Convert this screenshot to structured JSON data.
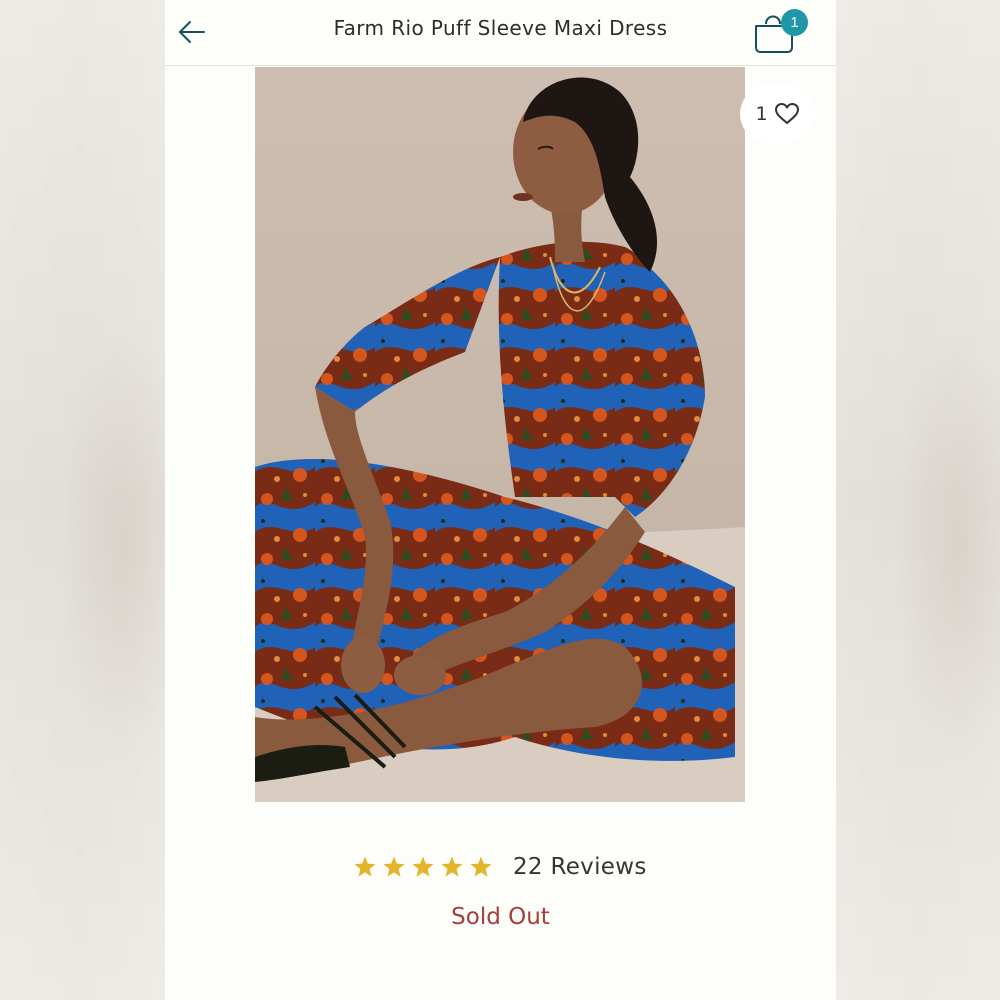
{
  "header": {
    "title": "Farm Rio Puff Sleeve Maxi Dress",
    "bag_count": "1"
  },
  "product": {
    "like_count": "1",
    "rating": 5,
    "reviews_label": "22 Reviews",
    "status": "Sold Out"
  },
  "colors": {
    "accent": "#1f97a6",
    "star": "#e3b52a",
    "sold_out": "#a3403b"
  },
  "icons": [
    "back-arrow-icon",
    "shopping-bag-icon",
    "heart-icon",
    "star-icon"
  ]
}
